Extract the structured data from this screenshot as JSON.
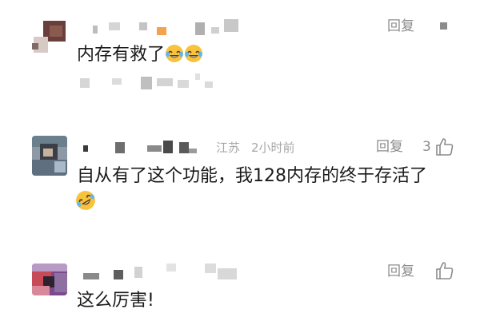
{
  "comments": [
    {
      "text": "内存有救了",
      "emojis": [
        "tears-of-joy-emoji",
        "tears-of-joy-emoji"
      ],
      "reply_label": "回复"
    },
    {
      "location": "江苏",
      "time": "2小时前",
      "reply_label": "回复",
      "likes": "3",
      "text": "自从有了这个功能，我128内存的终于存活了",
      "emojis": [
        "rofl-emoji"
      ]
    },
    {
      "reply_label": "回复",
      "text": "这么厉害!"
    }
  ],
  "icons": {
    "like": "thumbs-up-icon",
    "more": "more-icon"
  },
  "colors": {
    "text": "#1a1a1a",
    "meta": "#a8a8a8",
    "action": "#8c8c8c",
    "emoji_face": "#f7c23c"
  }
}
